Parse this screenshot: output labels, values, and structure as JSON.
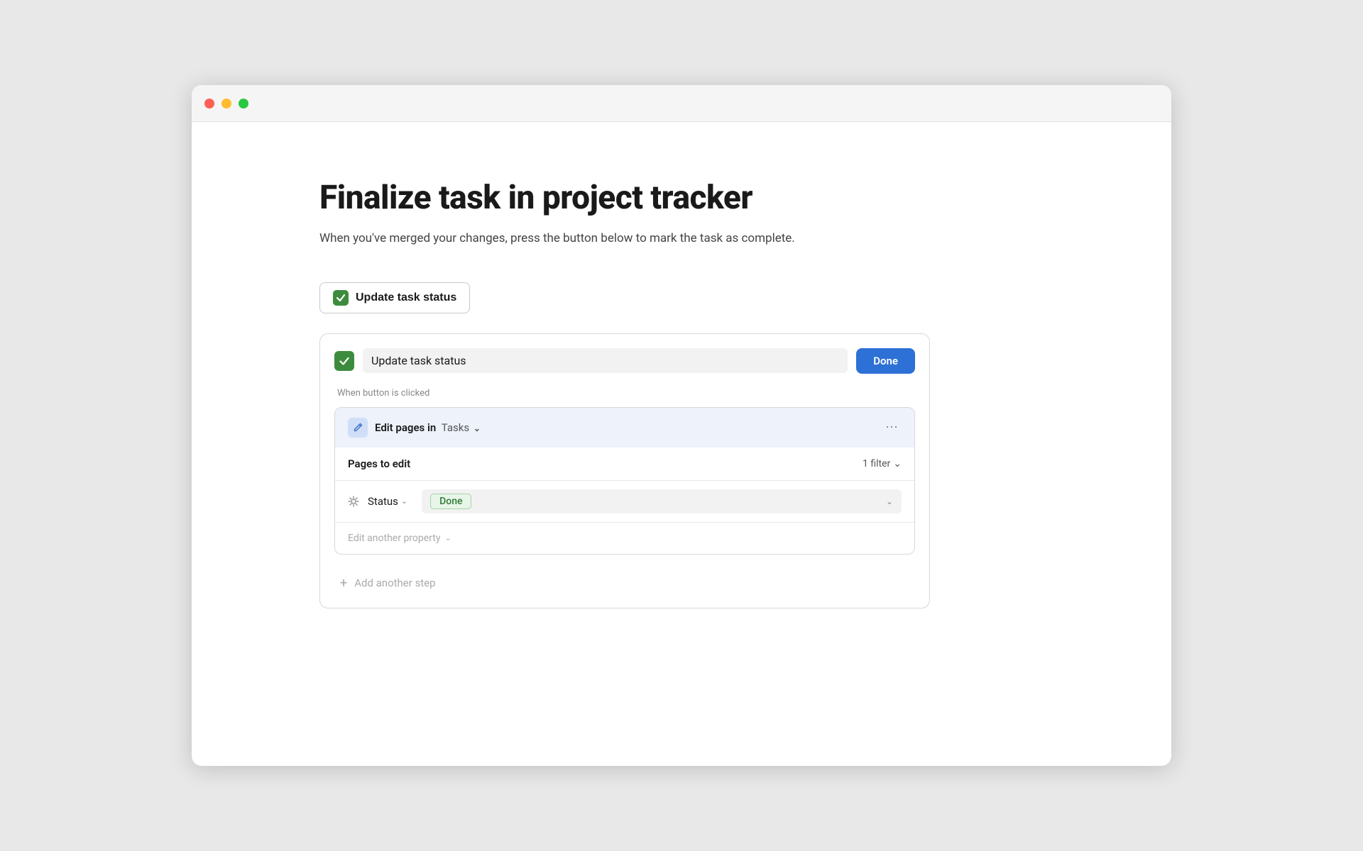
{
  "window": {
    "title": "Finalize task in project tracker"
  },
  "trafficLights": {
    "close": "close",
    "minimize": "minimize",
    "maximize": "maximize"
  },
  "page": {
    "title": "Finalize task in project tracker",
    "subtitle": "When you've merged your changes, press the button below to mark the task as complete."
  },
  "triggerButton": {
    "label": "Update task status"
  },
  "card": {
    "titleInput": "Update task status",
    "doneButton": "Done",
    "whenLabel": "When button is clicked",
    "step": {
      "editPagesLabel": "Edit pages in",
      "dbName": "Tasks",
      "pagesToEdit": "Pages to edit",
      "filterLabel": "1 filter",
      "statusLabel": "Status",
      "statusValue": "Done",
      "editAnotherProperty": "Edit another property",
      "addAnotherStep": "Add another step"
    }
  }
}
